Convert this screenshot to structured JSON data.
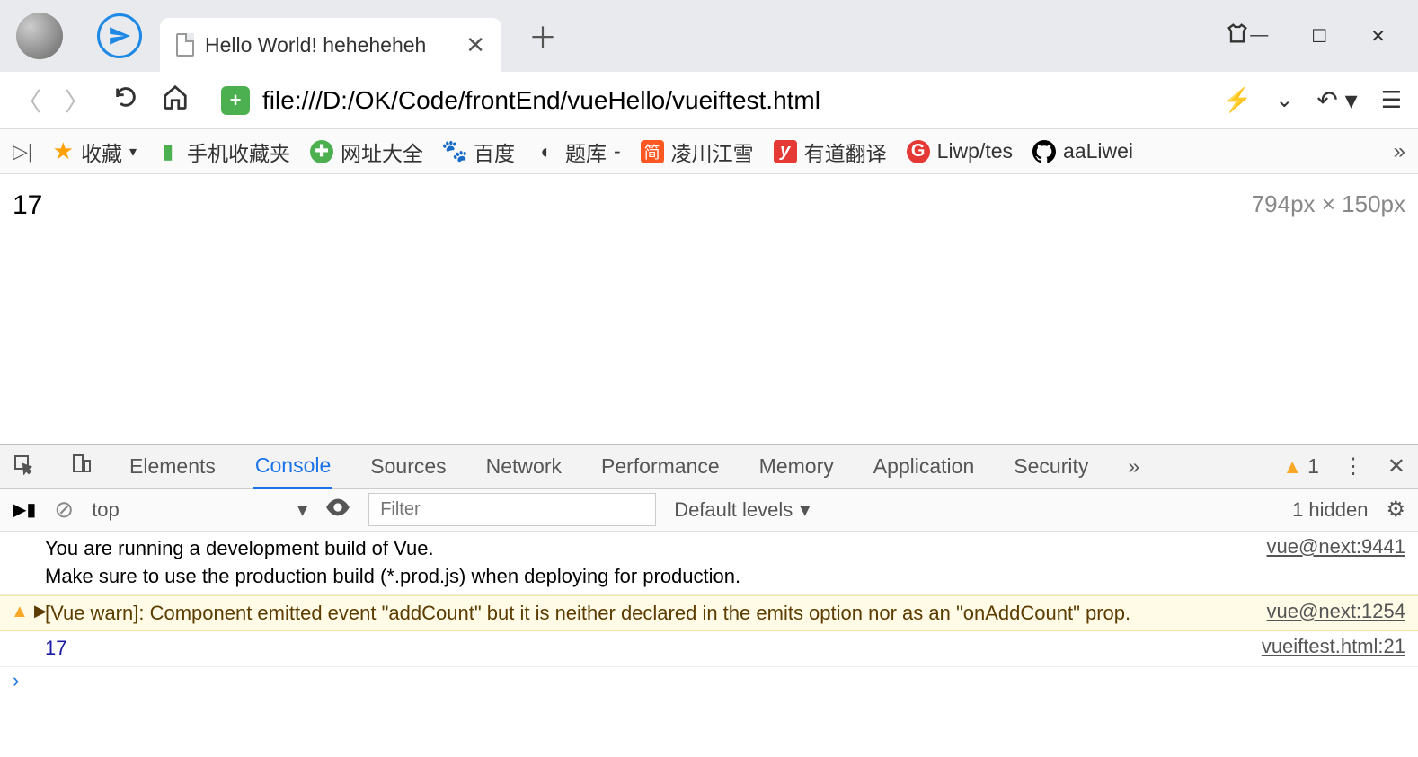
{
  "tab": {
    "title": "Hello World! heheheheh",
    "close": "✕"
  },
  "new_tab": "＋",
  "window_controls": {
    "min": "—",
    "max": "☐",
    "close": "✕"
  },
  "address": {
    "url": "file:///D:/OK/Code/frontEnd/vueHello/vueiftest.html"
  },
  "bookmarks": {
    "fav": "收藏",
    "mobile": "手机收藏夹",
    "site360": "网址大全",
    "baidu": "百度",
    "tiku": "题库",
    "tiku_suffix": "-",
    "jian": "凌川江雪",
    "youdao": "有道翻译",
    "liwp": "Liwp/tes",
    "gh": "aaLiwei",
    "more": "»"
  },
  "page": {
    "value": "17",
    "dim": "794px × 150px"
  },
  "devtools": {
    "tabs": [
      "Elements",
      "Console",
      "Sources",
      "Network",
      "Performance",
      "Memory",
      "Application",
      "Security"
    ],
    "more": "»",
    "warn_count": "1",
    "toolbar": {
      "context": "top",
      "filter_placeholder": "Filter",
      "levels": "Default levels",
      "hidden": "1 hidden"
    },
    "messages": {
      "m1_line1": "You are running a development build of Vue.",
      "m1_line2": "Make sure to use the production build (*.prod.js) when deploying for production.",
      "m1_src": "vue@next:9441",
      "m2": "[Vue warn]: Component emitted event \"addCount\" but it is neither declared in the emits option nor as an \"onAddCount\" prop.",
      "m2_src": "vue@next:1254",
      "m3": "17",
      "m3_src": "vueiftest.html:21"
    },
    "prompt": "›"
  }
}
